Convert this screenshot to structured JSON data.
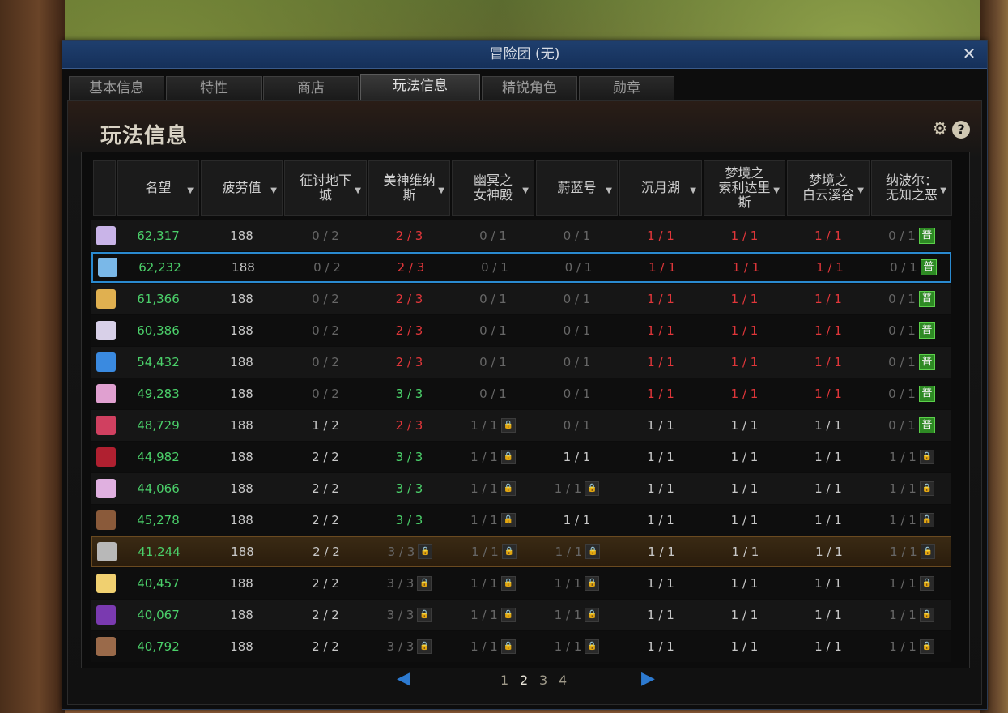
{
  "window": {
    "title": "冒险团 (无)",
    "close": "✕"
  },
  "tabs": [
    {
      "label": "基本信息",
      "active": false
    },
    {
      "label": "特性",
      "active": false
    },
    {
      "label": "商店",
      "active": false
    },
    {
      "label": "玩法信息",
      "active": true
    },
    {
      "label": "精锐角色",
      "active": false
    },
    {
      "label": "勋章",
      "active": false
    }
  ],
  "panel": {
    "title": "玩法信息"
  },
  "table": {
    "headers": [
      "名望",
      "疲劳值",
      "征讨地下城",
      "美神维纳斯",
      "幽冥之女神殿",
      "蔚蓝号",
      "沉月湖",
      "梦境之索利达里斯",
      "梦境之白云溪谷",
      "纳波尔：无知之恶"
    ],
    "header_display": [
      "名望",
      "疲劳值",
      "征讨地下\n城",
      "美神维纳\n斯",
      "幽冥之\n女神殿",
      "蔚蓝号",
      "沉月湖",
      "梦境之\n索利达里\n斯",
      "梦境之\n白云溪谷",
      "纳波尔：\n无知之恶"
    ],
    "badge": "普",
    "rows": [
      {
        "avatar": "#c9b4e8",
        "fame": "62,317",
        "fatigue": "188",
        "c": [
          [
            "0 / 2",
            "gray",
            0
          ],
          [
            "2 / 3",
            "red",
            0
          ],
          [
            "0 / 1",
            "gray",
            0
          ],
          [
            "0 / 1",
            "gray",
            0
          ],
          [
            "1 / 1",
            "red",
            0
          ],
          [
            "1 / 1",
            "red",
            0
          ],
          [
            "1 / 1",
            "red",
            0
          ],
          [
            "0 / 1",
            "gray",
            "pu"
          ]
        ]
      },
      {
        "avatar": "#7ab8e8",
        "fame": "62,232",
        "fatigue": "188",
        "selected": true,
        "c": [
          [
            "0 / 2",
            "gray",
            0
          ],
          [
            "2 / 3",
            "red",
            0
          ],
          [
            "0 / 1",
            "gray",
            0
          ],
          [
            "0 / 1",
            "gray",
            0
          ],
          [
            "1 / 1",
            "red",
            0
          ],
          [
            "1 / 1",
            "red",
            0
          ],
          [
            "1 / 1",
            "red",
            0
          ],
          [
            "0 / 1",
            "gray",
            "pu"
          ]
        ]
      },
      {
        "avatar": "#e0b050",
        "fame": "61,366",
        "fatigue": "188",
        "c": [
          [
            "0 / 2",
            "gray",
            0
          ],
          [
            "2 / 3",
            "red",
            0
          ],
          [
            "0 / 1",
            "gray",
            0
          ],
          [
            "0 / 1",
            "gray",
            0
          ],
          [
            "1 / 1",
            "red",
            0
          ],
          [
            "1 / 1",
            "red",
            0
          ],
          [
            "1 / 1",
            "red",
            0
          ],
          [
            "0 / 1",
            "gray",
            "pu"
          ]
        ]
      },
      {
        "avatar": "#d8d0e8",
        "fame": "60,386",
        "fatigue": "188",
        "c": [
          [
            "0 / 2",
            "gray",
            0
          ],
          [
            "2 / 3",
            "red",
            0
          ],
          [
            "0 / 1",
            "gray",
            0
          ],
          [
            "0 / 1",
            "gray",
            0
          ],
          [
            "1 / 1",
            "red",
            0
          ],
          [
            "1 / 1",
            "red",
            0
          ],
          [
            "1 / 1",
            "red",
            0
          ],
          [
            "0 / 1",
            "gray",
            "pu"
          ]
        ]
      },
      {
        "avatar": "#3a8ae0",
        "fame": "54,432",
        "fatigue": "188",
        "c": [
          [
            "0 / 2",
            "gray",
            0
          ],
          [
            "2 / 3",
            "red",
            0
          ],
          [
            "0 / 1",
            "gray",
            0
          ],
          [
            "0 / 1",
            "gray",
            0
          ],
          [
            "1 / 1",
            "red",
            0
          ],
          [
            "1 / 1",
            "red",
            0
          ],
          [
            "1 / 1",
            "red",
            0
          ],
          [
            "0 / 1",
            "gray",
            "pu"
          ]
        ]
      },
      {
        "avatar": "#e0a0d0",
        "fame": "49,283",
        "fatigue": "188",
        "c": [
          [
            "0 / 2",
            "gray",
            0
          ],
          [
            "3 / 3",
            "green",
            0
          ],
          [
            "0 / 1",
            "gray",
            0
          ],
          [
            "0 / 1",
            "gray",
            0
          ],
          [
            "1 / 1",
            "red",
            0
          ],
          [
            "1 / 1",
            "red",
            0
          ],
          [
            "1 / 1",
            "red",
            0
          ],
          [
            "0 / 1",
            "gray",
            "pu"
          ]
        ]
      },
      {
        "avatar": "#d04060",
        "fame": "48,729",
        "fatigue": "188",
        "c": [
          [
            "1 / 2",
            "white",
            0
          ],
          [
            "2 / 3",
            "red",
            0
          ],
          [
            "1 / 1",
            "gray",
            "lock"
          ],
          [
            "0 / 1",
            "gray",
            0
          ],
          [
            "1 / 1",
            "white",
            0
          ],
          [
            "1 / 1",
            "white",
            0
          ],
          [
            "1 / 1",
            "white",
            0
          ],
          [
            "0 / 1",
            "gray",
            "pu"
          ]
        ]
      },
      {
        "avatar": "#b02030",
        "fame": "44,982",
        "fatigue": "188",
        "c": [
          [
            "2 / 2",
            "white",
            0
          ],
          [
            "3 / 3",
            "green",
            0
          ],
          [
            "1 / 1",
            "gray",
            "lock"
          ],
          [
            "1 / 1",
            "white",
            0
          ],
          [
            "1 / 1",
            "white",
            0
          ],
          [
            "1 / 1",
            "white",
            0
          ],
          [
            "1 / 1",
            "white",
            0
          ],
          [
            "1 / 1",
            "gray",
            "lock"
          ]
        ]
      },
      {
        "avatar": "#e0b0e0",
        "fame": "44,066",
        "fatigue": "188",
        "c": [
          [
            "2 / 2",
            "white",
            0
          ],
          [
            "3 / 3",
            "green",
            0
          ],
          [
            "1 / 1",
            "gray",
            "lock"
          ],
          [
            "1 / 1",
            "gray",
            "lock"
          ],
          [
            "1 / 1",
            "white",
            0
          ],
          [
            "1 / 1",
            "white",
            0
          ],
          [
            "1 / 1",
            "white",
            0
          ],
          [
            "1 / 1",
            "gray",
            "lock"
          ]
        ]
      },
      {
        "avatar": "#8a5a3a",
        "fame": "45,278",
        "fatigue": "188",
        "c": [
          [
            "2 / 2",
            "white",
            0
          ],
          [
            "3 / 3",
            "green",
            0
          ],
          [
            "1 / 1",
            "gray",
            "lock"
          ],
          [
            "1 / 1",
            "white",
            0
          ],
          [
            "1 / 1",
            "white",
            0
          ],
          [
            "1 / 1",
            "white",
            0
          ],
          [
            "1 / 1",
            "white",
            0
          ],
          [
            "1 / 1",
            "gray",
            "lock"
          ]
        ]
      },
      {
        "avatar": "#b8b8b8",
        "fame": "41,244",
        "fatigue": "188",
        "highlight": true,
        "c": [
          [
            "2 / 2",
            "white",
            0
          ],
          [
            "3 / 3",
            "gray",
            "lock"
          ],
          [
            "1 / 1",
            "gray",
            "lock"
          ],
          [
            "1 / 1",
            "gray",
            "lock"
          ],
          [
            "1 / 1",
            "white",
            0
          ],
          [
            "1 / 1",
            "white",
            0
          ],
          [
            "1 / 1",
            "white",
            0
          ],
          [
            "1 / 1",
            "gray",
            "lock"
          ]
        ]
      },
      {
        "avatar": "#f0d070",
        "fame": "40,457",
        "fatigue": "188",
        "c": [
          [
            "2 / 2",
            "white",
            0
          ],
          [
            "3 / 3",
            "gray",
            "lock"
          ],
          [
            "1 / 1",
            "gray",
            "lock"
          ],
          [
            "1 / 1",
            "gray",
            "lock"
          ],
          [
            "1 / 1",
            "white",
            0
          ],
          [
            "1 / 1",
            "white",
            0
          ],
          [
            "1 / 1",
            "white",
            0
          ],
          [
            "1 / 1",
            "gray",
            "lock"
          ]
        ]
      },
      {
        "avatar": "#7a3ab0",
        "fame": "40,067",
        "fatigue": "188",
        "c": [
          [
            "2 / 2",
            "white",
            0
          ],
          [
            "3 / 3",
            "gray",
            "lock"
          ],
          [
            "1 / 1",
            "gray",
            "lock"
          ],
          [
            "1 / 1",
            "gray",
            "lock"
          ],
          [
            "1 / 1",
            "white",
            0
          ],
          [
            "1 / 1",
            "white",
            0
          ],
          [
            "1 / 1",
            "white",
            0
          ],
          [
            "1 / 1",
            "gray",
            "lock"
          ]
        ]
      },
      {
        "avatar": "#9a6a4a",
        "fame": "40,792",
        "fatigue": "188",
        "c": [
          [
            "2 / 2",
            "white",
            0
          ],
          [
            "3 / 3",
            "gray",
            "lock"
          ],
          [
            "1 / 1",
            "gray",
            "lock"
          ],
          [
            "1 / 1",
            "gray",
            "lock"
          ],
          [
            "1 / 1",
            "white",
            0
          ],
          [
            "1 / 1",
            "white",
            0
          ],
          [
            "1 / 1",
            "white",
            0
          ],
          [
            "1 / 1",
            "gray",
            "lock"
          ]
        ]
      }
    ]
  },
  "pager": {
    "pages": [
      "1",
      "2",
      "3",
      "4"
    ],
    "current": "2",
    "prev_icon": "◀",
    "next_icon": "▶"
  }
}
